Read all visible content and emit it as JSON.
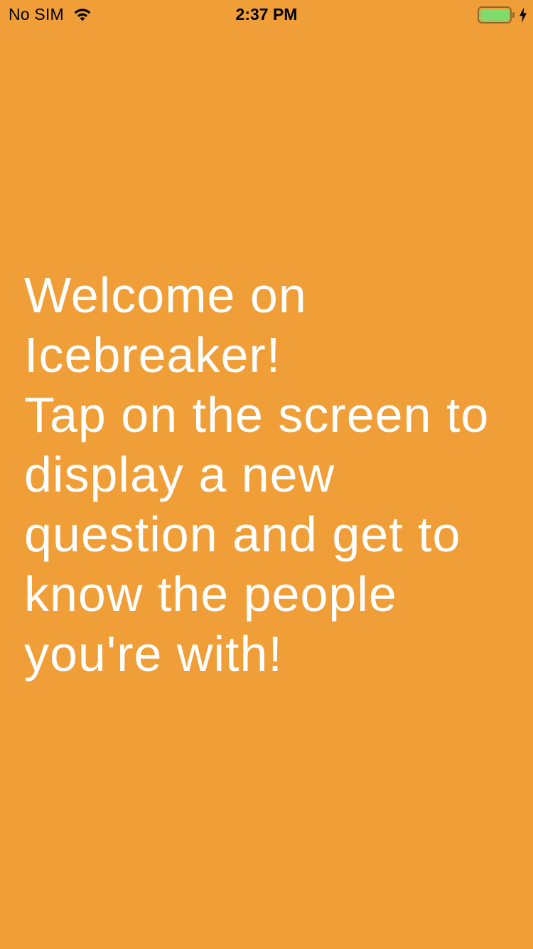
{
  "status_bar": {
    "carrier": "No SIM",
    "time": "2:37 PM",
    "wifi_icon": "wifi-icon",
    "battery_icon": "battery-icon",
    "charging_icon": "bolt-icon",
    "battery_level": 1.0,
    "battery_fill_color": "#7EDC6F"
  },
  "screen": {
    "background_color": "#F09E38",
    "text_color": "#FFFFFF",
    "welcome_text": "Welcome on\nIcebreaker!\nTap on the screen to\ndisplay a new\nquestion and get to\nknow the people\nyou're with!"
  }
}
